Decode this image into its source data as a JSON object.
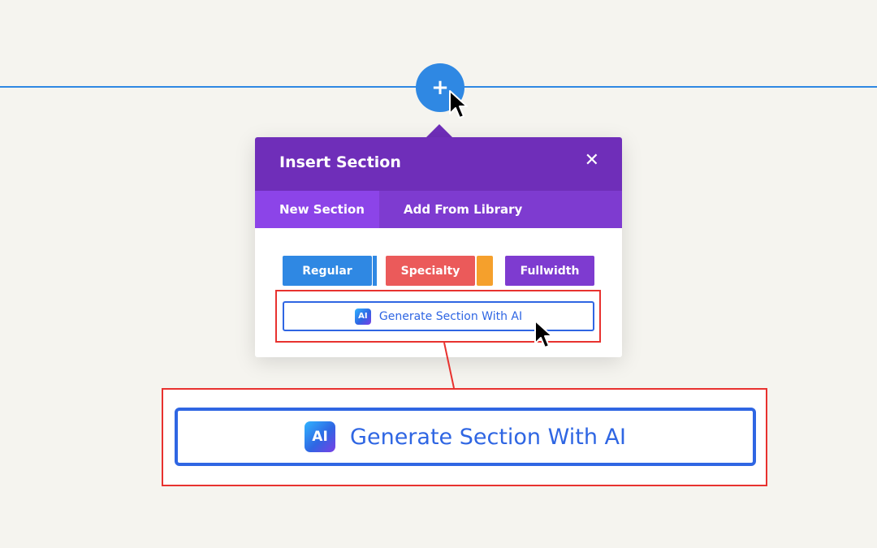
{
  "add_button": {
    "symbol": "+"
  },
  "dialog": {
    "title": "Insert Section",
    "close_symbol": "✕",
    "tabs": [
      {
        "label": "New Section",
        "active": true
      },
      {
        "label": "Add From Library",
        "active": false
      }
    ],
    "section_types": [
      {
        "label": "Regular",
        "color": "#2f88e3"
      },
      {
        "label": "Specialty",
        "color": "#eb5a5a"
      },
      {
        "label": "Fullwidth",
        "color": "#7e3bd0"
      }
    ],
    "generate_button": {
      "icon_text": "AI",
      "label": "Generate Section With AI"
    }
  },
  "zoomed_callout": {
    "icon_text": "AI",
    "label": "Generate Section With AI"
  },
  "colors": {
    "background": "#f5f4ef",
    "accent_blue": "#2f88e3",
    "header_purple": "#6f2eb9",
    "tab_purple": "#7e3bd0",
    "active_tab": "#8c44e8",
    "ai_blue": "#2f66e3",
    "highlight_red": "#e8322f"
  },
  "icons": {
    "cursor": "arrow-pointer-icon",
    "close": "close-icon",
    "ai": "ai-badge-icon"
  }
}
